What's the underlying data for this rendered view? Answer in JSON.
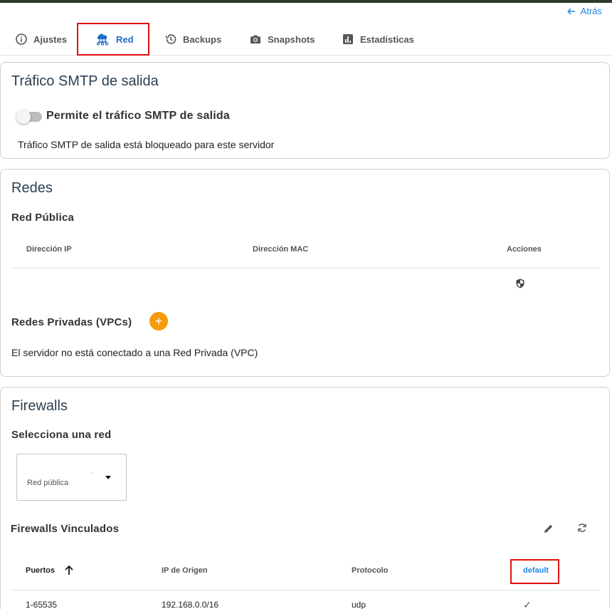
{
  "nav": {
    "back_label": "Atrás"
  },
  "tabs": [
    {
      "label": "Ajustes",
      "icon": "info-icon"
    },
    {
      "label": "Red",
      "icon": "network-cloud-icon",
      "active": true
    },
    {
      "label": "Backups",
      "icon": "history-icon"
    },
    {
      "label": "Snapshots",
      "icon": "camera-icon"
    },
    {
      "label": "Estadísticas",
      "icon": "bar-chart-icon"
    }
  ],
  "smtp": {
    "title": "Tráfico SMTP de salida",
    "toggle_label": "Permite el tráfico SMTP de salida",
    "toggle_on": false,
    "status_text": "Tráfico SMTP de salida está bloqueado para este servidor"
  },
  "networks": {
    "title": "Redes",
    "public": {
      "title": "Red Pública",
      "columns": [
        "Dirección IP",
        "Dirección MAC",
        "Acciones"
      ]
    },
    "private": {
      "title": "Redes Privadas (VPCs)",
      "add_label": "+",
      "empty_text": "El servidor no está conectado a una Red Privada (VPC)"
    }
  },
  "firewalls": {
    "title": "Firewalls",
    "select_title": "Selecciona una red",
    "select_value": "Red pública",
    "select_mark": "ͅ",
    "linked_title": "Firewalls Vinculados",
    "columns": [
      "Puertos",
      "IP de Origen",
      "Protocolo",
      "default"
    ],
    "rows": [
      {
        "ports": "1-65535",
        "source": "192.168.0.0/16",
        "protocol": "udp",
        "default": "✓"
      }
    ]
  },
  "colors": {
    "accent": "#1e88e5",
    "fab": "#f59a0c",
    "highlight": "#e01010"
  }
}
